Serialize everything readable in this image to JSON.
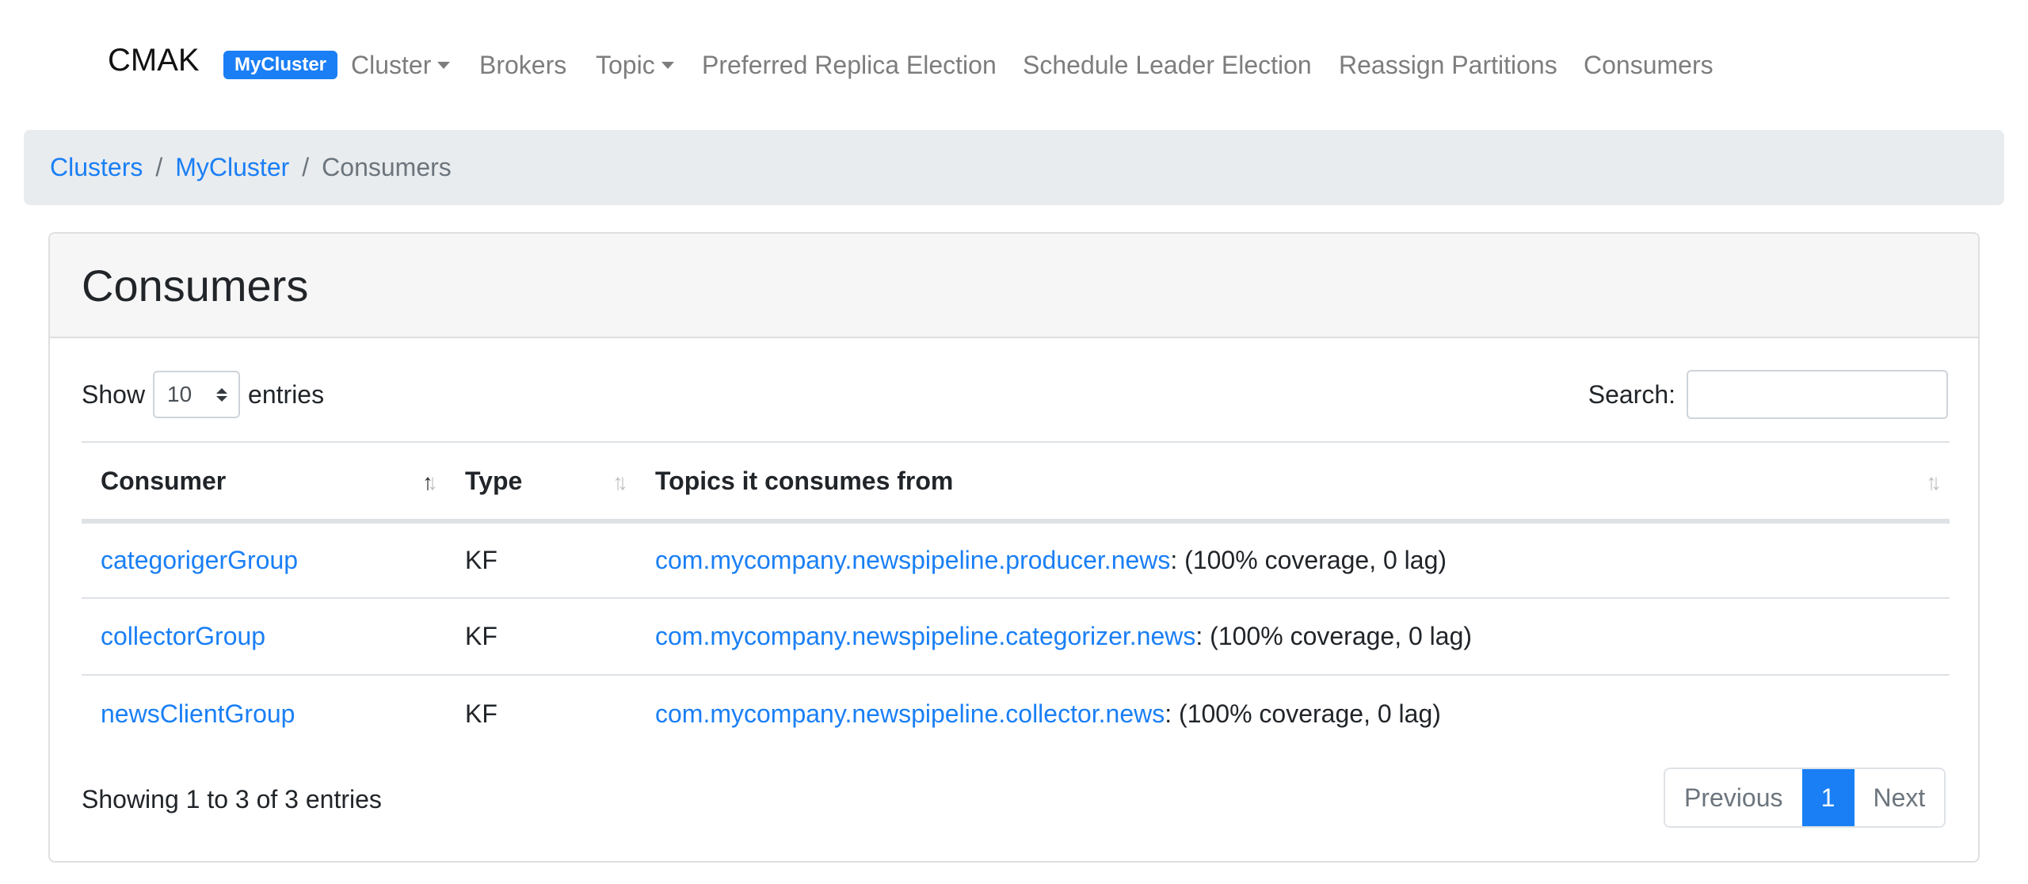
{
  "navbar": {
    "brand": "CMAK",
    "cluster_badge": "MyCluster",
    "items": [
      {
        "label": "Cluster",
        "dropdown": true
      },
      {
        "label": "Brokers",
        "dropdown": false
      },
      {
        "label": "Topic",
        "dropdown": true
      },
      {
        "label": "Preferred Replica Election",
        "dropdown": false
      },
      {
        "label": "Schedule Leader Election",
        "dropdown": false
      },
      {
        "label": "Reassign Partitions",
        "dropdown": false
      },
      {
        "label": "Consumers",
        "dropdown": false
      }
    ]
  },
  "breadcrumb": {
    "items": [
      "Clusters",
      "MyCluster",
      "Consumers"
    ],
    "separator": "/"
  },
  "card": {
    "title": "Consumers"
  },
  "table_controls": {
    "show_label": "Show",
    "page_length": "10",
    "entries_label": "entries",
    "search_label": "Search:",
    "search_value": "",
    "search_placeholder": ""
  },
  "table": {
    "columns": [
      {
        "label": "Consumer",
        "sort": "ascending"
      },
      {
        "label": "Type",
        "sort": "none"
      },
      {
        "label": "Topics it consumes from",
        "sort": "none"
      }
    ],
    "rows": [
      {
        "consumer": "categorigerGroup",
        "type": "KF",
        "topic": "com.mycompany.newspipeline.producer.news",
        "detail": ": (100% coverage, 0 lag)"
      },
      {
        "consumer": "collectorGroup",
        "type": "KF",
        "topic": "com.mycompany.newspipeline.categorizer.news",
        "detail": ": (100% coverage, 0 lag)"
      },
      {
        "consumer": "newsClientGroup",
        "type": "KF",
        "topic": "com.mycompany.newspipeline.collector.news",
        "detail": ": (100% coverage, 0 lag)"
      }
    ]
  },
  "footer": {
    "info": "Showing 1 to 3 of 3 entries",
    "pagination": {
      "previous": "Previous",
      "current": "1",
      "next": "Next"
    }
  },
  "colors": {
    "accent": "#1a7ff5",
    "breadcrumb_bg": "#e9ecef",
    "nav_text": "#7d7d7d",
    "muted": "#6c757d"
  }
}
